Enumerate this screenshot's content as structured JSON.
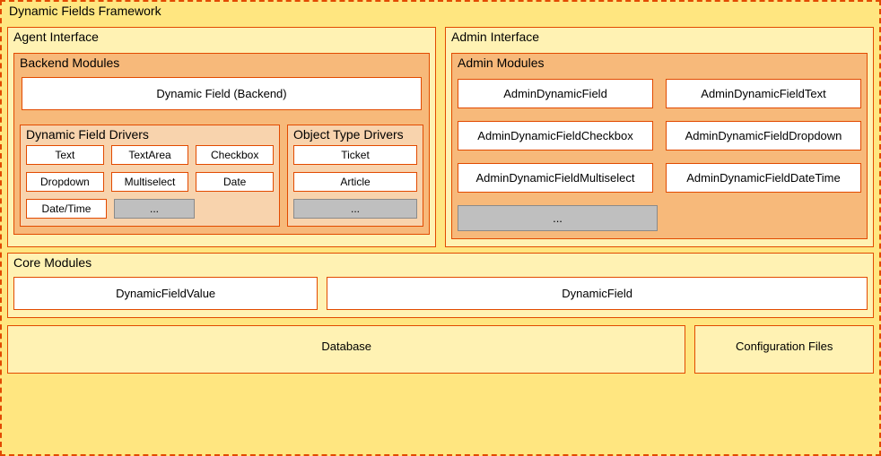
{
  "framework": {
    "title": "Dynamic Fields Framework"
  },
  "agent": {
    "title": "Agent Interface",
    "backend": {
      "title": "Backend Modules",
      "main": "Dynamic Field (Backend)",
      "fieldDrivers": {
        "title": "Dynamic Field Drivers",
        "items": [
          "Text",
          "TextArea",
          "Checkbox",
          "Dropdown",
          "Multiselect",
          "Date",
          "Date/Time"
        ],
        "more": "..."
      },
      "objectDrivers": {
        "title": "Object Type Drivers",
        "items": [
          "Ticket",
          "Article"
        ],
        "more": "..."
      }
    }
  },
  "admin": {
    "title": "Admin Interface",
    "modules": {
      "title": "Admin Modules",
      "items": [
        "AdminDynamicField",
        "AdminDynamicFieldText",
        "AdminDynamicFieldCheckbox",
        "AdminDynamicFieldDropdown",
        "AdminDynamicFieldMultiselect",
        "AdminDynamicFieldDateTime"
      ],
      "more": "..."
    }
  },
  "core": {
    "title": "Core Modules",
    "items": [
      "DynamicFieldValue",
      "DynamicField"
    ]
  },
  "storage": {
    "database": "Database",
    "config": "Configuration Files"
  }
}
